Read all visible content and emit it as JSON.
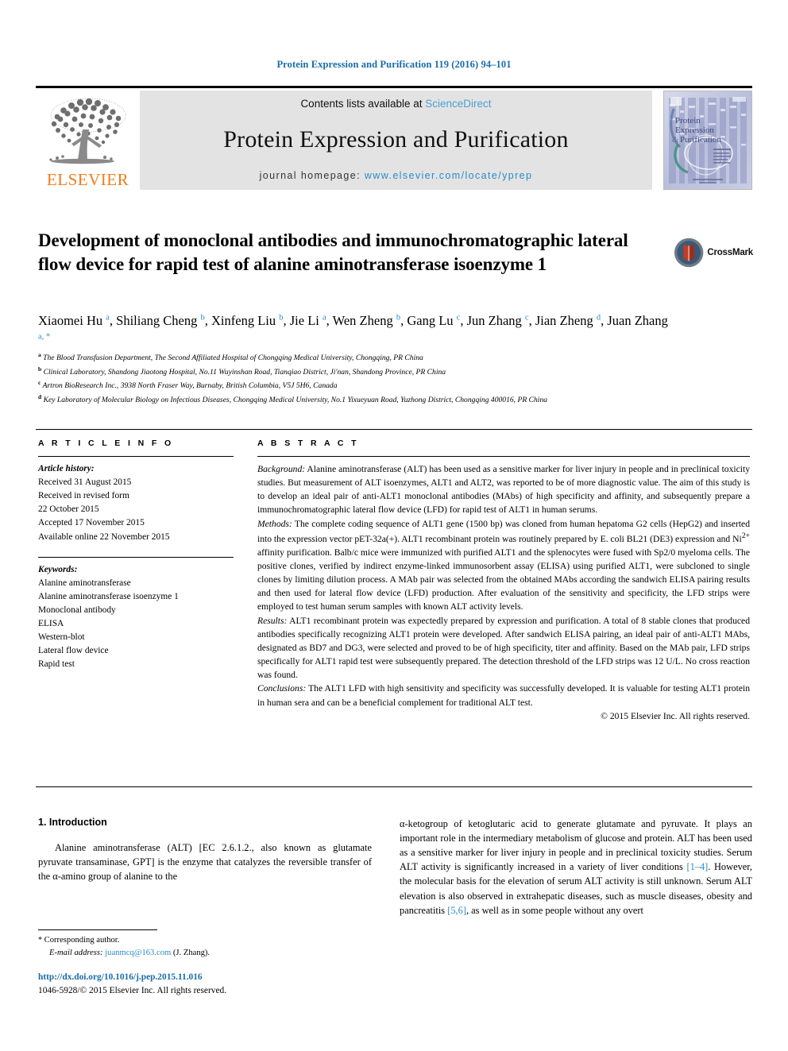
{
  "running_head": "Protein Expression and Purification 119 (2016) 94–101",
  "masthead": {
    "publisher_name": "ELSEVIER",
    "contents_prefix": "Contents lists available at ",
    "contents_link": "ScienceDirect",
    "journal_title": "Protein Expression and Purification",
    "homepage_prefix": "journal homepage: ",
    "homepage_url": "www.elsevier.com/locate/yprep",
    "cover_title_line1": "Protein",
    "cover_title_line2": "Expression",
    "cover_title_line3": "Purification",
    "cover_amp": "&"
  },
  "article": {
    "title": "Development of monoclonal antibodies and immunochromatographic lateral flow device for rapid test of alanine aminotransferase isoenzyme 1",
    "crossmark_label": "CrossMark",
    "authors": [
      {
        "name": "Xiaomei Hu",
        "sup": "a",
        "sep": ", "
      },
      {
        "name": "Shiliang Cheng",
        "sup": "b",
        "sep": ", "
      },
      {
        "name": "Xinfeng Liu",
        "sup": "b",
        "sep": ", "
      },
      {
        "name": "Jie Li",
        "sup": "a",
        "sep": ", "
      },
      {
        "name": "Wen Zheng",
        "sup": "b",
        "sep": ", "
      },
      {
        "name": "Gang Lu",
        "sup": "c",
        "sep": ", "
      },
      {
        "name": "Jun Zhang",
        "sup": "c",
        "sep": ", "
      },
      {
        "name": "Jian Zheng",
        "sup": "d",
        "sep": ", "
      },
      {
        "name": "Juan Zhang",
        "sup": "a, *",
        "sep": ""
      }
    ],
    "affiliations": [
      {
        "marker": "a",
        "text": "The Blood Transfusion Department, The Second Affiliated Hospital of Chongqing Medical University, Chongqing, PR China"
      },
      {
        "marker": "b",
        "text": "Clinical Laboratory, Shandong Jiaotong Hospital, No.11 Wuyinshan Road, Tianqiao District, Ji'nan, Shandong Province, PR China"
      },
      {
        "marker": "c",
        "text": "Artron BioResearch Inc., 3938 North Fraser Way, Burnaby, British Columbia, V5J 5H6, Canada"
      },
      {
        "marker": "d",
        "text": "Key Laboratory of Molecular Biology on Infectious Diseases, Chongqing Medical University, No.1 Yixueyuan Road, Yuzhong District, Chongqing 400016, PR China"
      }
    ]
  },
  "article_info": {
    "heading": "A R T I C L E   I N F O",
    "history_label": "Article history:",
    "history": [
      "Received 31 August 2015",
      "Received in revised form",
      "22 October 2015",
      "Accepted 17 November 2015",
      "Available online 22 November 2015"
    ],
    "keywords_label": "Keywords:",
    "keywords": [
      "Alanine aminotransferase",
      "Alanine aminotransferase isoenzyme 1",
      "Monoclonal antibody",
      "ELISA",
      "Western-blot",
      "Lateral flow device",
      "Rapid test"
    ]
  },
  "abstract": {
    "heading": "A B S T R A C T",
    "background_label": "Background:",
    "background_text": " Alanine aminotransferase (ALT) has been used as a sensitive marker for liver injury in people and in preclinical toxicity studies. But measurement of ALT isoenzymes, ALT1 and ALT2, was reported to be of more diagnostic value. The aim of this study is to develop an ideal pair of anti-ALT1 monoclonal antibodies (MAbs) of high specificity and affinity, and subsequently prepare a immunochromatographic lateral flow device (LFD) for rapid test of ALT1 in human serums.",
    "methods_label": "Methods:",
    "methods_text_1": " The complete coding sequence of ALT1 gene (1500 bp) was cloned from human hepatoma G2 cells (HepG2) and inserted into the expression vector pET-32a(+). ALT1 recombinant protein was routinely prepared by E. coli BL21 (DE3) expression and Ni",
    "methods_sup": "2+",
    "methods_text_2": " affinity purification. Balb/c mice were immunized with purified ALT1 and the splenocytes were fused with Sp2/0 myeloma cells. The positive clones, verified by indirect enzyme-linked immunosorbent assay (ELISA) using purified ALT1, were subcloned to single clones by limiting dilution process. A MAb pair was selected from the obtained MAbs according the sandwich ELISA pairing results and then used for lateral flow device (LFD) production. After evaluation of the sensitivity and specificity, the LFD strips were employed to test human serum samples with known ALT activity levels.",
    "results_label": "Results:",
    "results_text": " ALT1 recombinant protein was expectedly prepared by expression and purification. A total of 8 stable clones that produced antibodies specifically recognizing ALT1 protein were developed. After sandwich ELISA pairing, an ideal pair of anti-ALT1 MAbs, designated as BD7 and DG3, were selected and proved to be of high specificity, titer and affinity. Based on the MAb pair, LFD strips specifically for ALT1 rapid test were subsequently prepared. The detection threshold of the LFD strips was 12 U/L. No cross reaction was found.",
    "conclusions_label": "Conclusions:",
    "conclusions_text": " The ALT1 LFD with high sensitivity and specificity was successfully developed. It is valuable for testing ALT1 protein in human sera and can be a beneficial complement for traditional ALT test.",
    "copyright": "© 2015 Elsevier Inc. All rights reserved."
  },
  "introduction": {
    "heading": "1. Introduction",
    "left_text_pre": "Alanine aminotransferase (ALT) [EC 2.6.1.2., also known as glutamate pyruvate transaminase, GPT] is the enzyme that catalyzes the reversible transfer of the α-amino group of alanine to the",
    "right_text_1": "α-ketogroup of ketoglutaric acid to generate glutamate and pyruvate. It plays an important role in the intermediary metabolism of glucose and protein. ALT has been used as a sensitive marker for liver injury in people and in preclinical toxicity studies. Serum ALT activity is significantly increased in a variety of liver conditions ",
    "ref_1": "[1–4]",
    "right_text_2": ". However, the molecular basis for the elevation of serum ALT activity is still unknown. Serum ALT elevation is also observed in extrahepatic diseases, such as muscle diseases, obesity and pancreatitis ",
    "ref_2": "[5,6]",
    "right_text_3": ", as well as in some people without any overt"
  },
  "footer": {
    "corresponding_marker": "*",
    "corresponding_label": " Corresponding author.",
    "email_label": "E-mail address:",
    "email": "juanmcq@163.com",
    "email_owner": " (J. Zhang).",
    "doi": "http://dx.doi.org/10.1016/j.pep.2015.11.016",
    "issn": "1046-5928/© 2015 Elsevier Inc. All rights reserved."
  },
  "colors": {
    "link_blue": "#2b8bc8",
    "header_blue": "#1a6ca8",
    "sciencedirect_blue": "#4a9fd5",
    "elsevier_orange": "#ef7d1a",
    "band_gray": "#e3e3e3"
  }
}
